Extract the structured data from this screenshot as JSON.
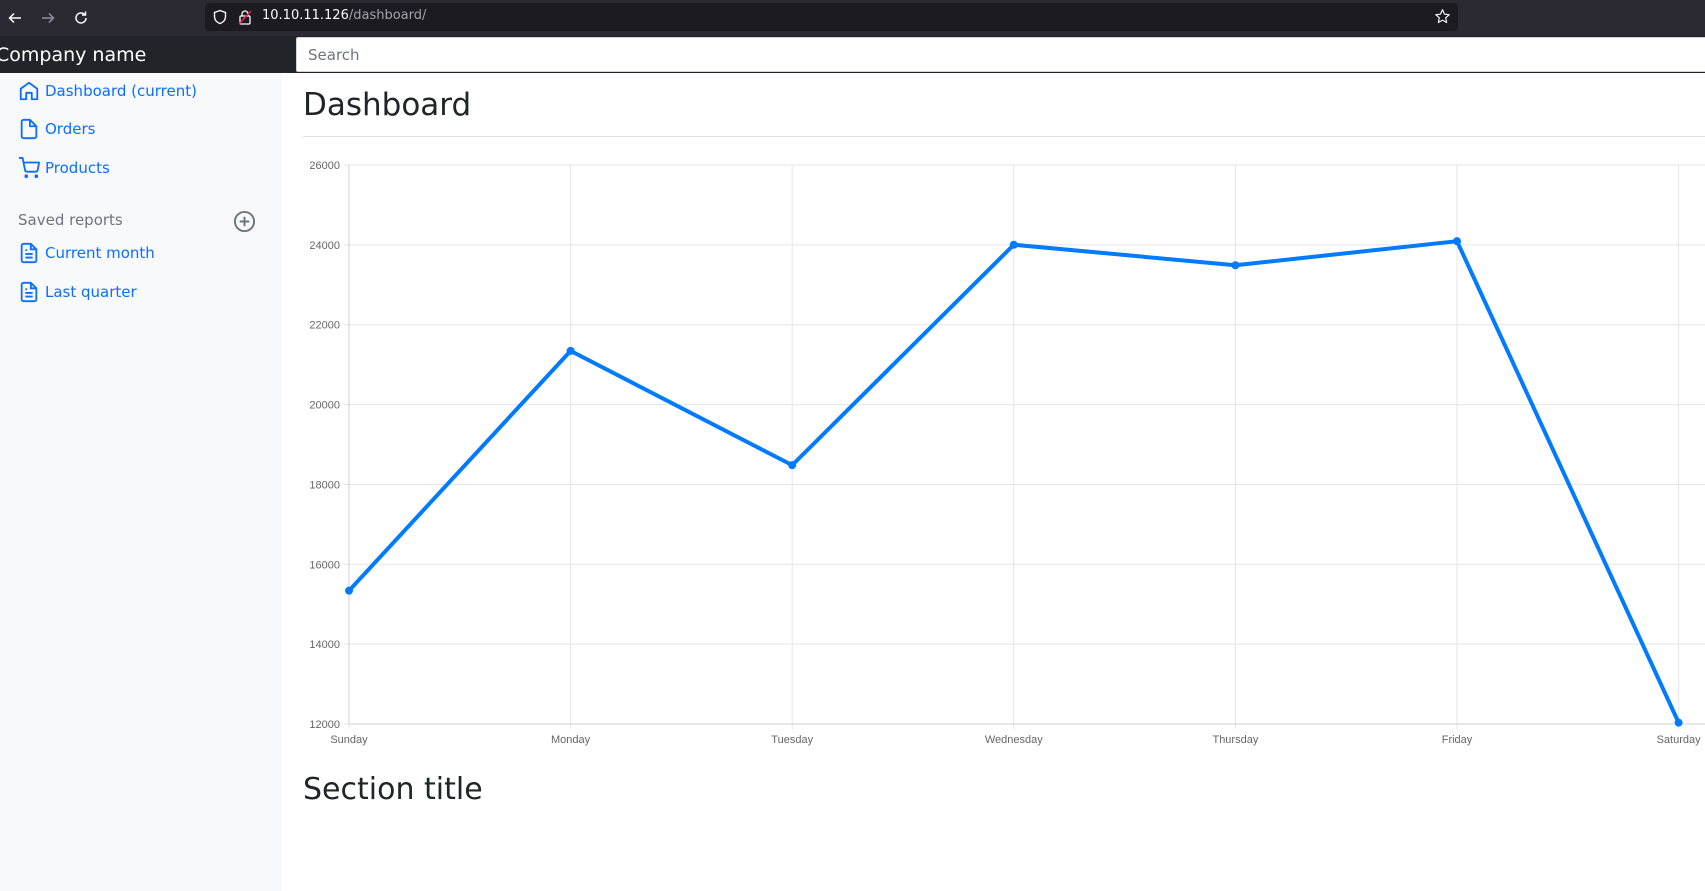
{
  "browser": {
    "url_host": "10.10.11.126",
    "url_path": "/dashboard/"
  },
  "navbar": {
    "brand": "Company name",
    "search_placeholder": "Search"
  },
  "sidebar": {
    "items": [
      {
        "label": "Dashboard (current)",
        "icon": "home-icon"
      },
      {
        "label": "Orders",
        "icon": "file-icon"
      },
      {
        "label": "Products",
        "icon": "shopping-cart-icon"
      }
    ],
    "saved_reports_heading": "Saved reports",
    "reports": [
      {
        "label": "Current month",
        "icon": "file-text-icon"
      },
      {
        "label": "Last quarter",
        "icon": "file-text-icon"
      }
    ]
  },
  "main": {
    "title": "Dashboard",
    "section_title": "Section title"
  },
  "colors": {
    "accent": "#007bff",
    "link": "#0d6efd"
  },
  "chart_data": {
    "type": "line",
    "categories": [
      "Sunday",
      "Monday",
      "Tuesday",
      "Wednesday",
      "Thursday",
      "Friday",
      "Saturday"
    ],
    "values": [
      15339,
      21345,
      18483,
      24003,
      23489,
      24092,
      12034
    ],
    "ylim": [
      12000,
      26000
    ],
    "yticks": [
      12000,
      14000,
      16000,
      18000,
      20000,
      22000,
      24000,
      26000
    ],
    "grid": true,
    "legend": "none"
  }
}
